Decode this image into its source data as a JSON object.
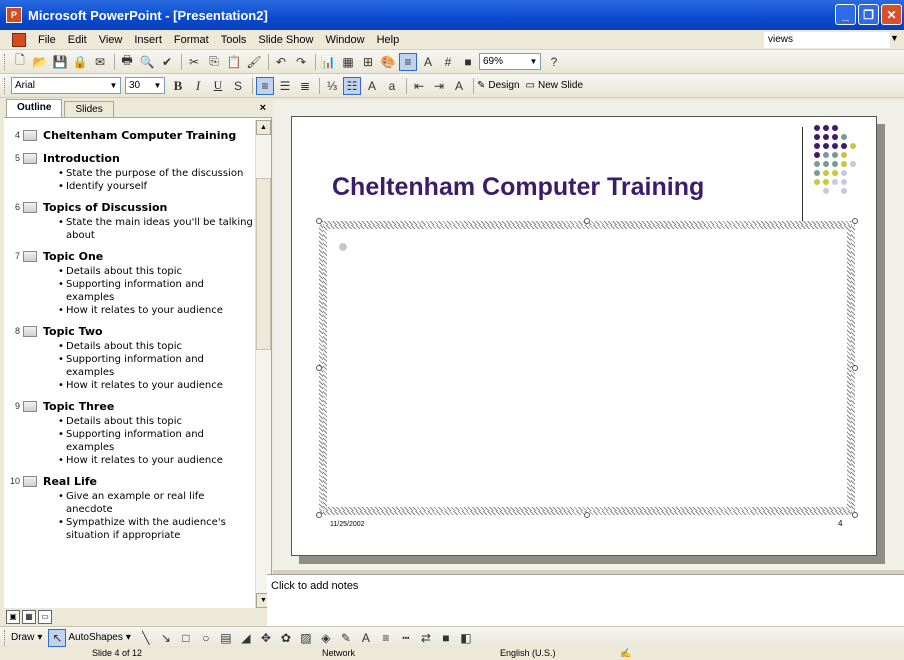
{
  "window": {
    "title": "Microsoft PowerPoint - [Presentation2]"
  },
  "menubar": {
    "items": [
      "File",
      "Edit",
      "View",
      "Insert",
      "Format",
      "Tools",
      "Slide Show",
      "Window",
      "Help"
    ],
    "help_box": "views"
  },
  "toolbar": {
    "zoom": "69%",
    "font_name": "Arial",
    "font_size": "30",
    "design_label": "Design",
    "new_slide_label": "New Slide"
  },
  "outline_pane": {
    "tabs": [
      "Outline",
      "Slides"
    ],
    "close": "×",
    "slides": [
      {
        "num": "4",
        "title": "Cheltenham Computer Training",
        "bullets": []
      },
      {
        "num": "5",
        "title": "Introduction",
        "bullets": [
          "State the purpose of the discussion",
          "Identify yourself"
        ]
      },
      {
        "num": "6",
        "title": "Topics of Discussion",
        "bullets": [
          "State the main ideas you'll be talking about"
        ]
      },
      {
        "num": "7",
        "title": "Topic One",
        "bullets": [
          "Details about this topic",
          "Supporting information and examples",
          "How it relates to your audience"
        ]
      },
      {
        "num": "8",
        "title": "Topic Two",
        "bullets": [
          "Details about this topic",
          "Supporting information and examples",
          "How it relates to your audience"
        ]
      },
      {
        "num": "9",
        "title": "Topic Three",
        "bullets": [
          "Details about this topic",
          "Supporting information and examples",
          "How it relates to your audience"
        ]
      },
      {
        "num": "10",
        "title": "Real Life",
        "bullets": [
          "Give an example or real life anecdote",
          "Sympathize with the audience's situation if appropriate"
        ]
      }
    ]
  },
  "slide": {
    "title": "Cheltenham Computer Training",
    "date": "11/25/2002",
    "number": "4",
    "title_color": "#3d1b6a"
  },
  "notes": {
    "placeholder": "Click to add notes"
  },
  "drawbar": {
    "draw_label": "Draw",
    "autoshapes_label": "AutoShapes"
  },
  "statusbar": {
    "slide_info": "Slide 4 of 12",
    "design": "Network",
    "language": "English (U.S.)"
  }
}
